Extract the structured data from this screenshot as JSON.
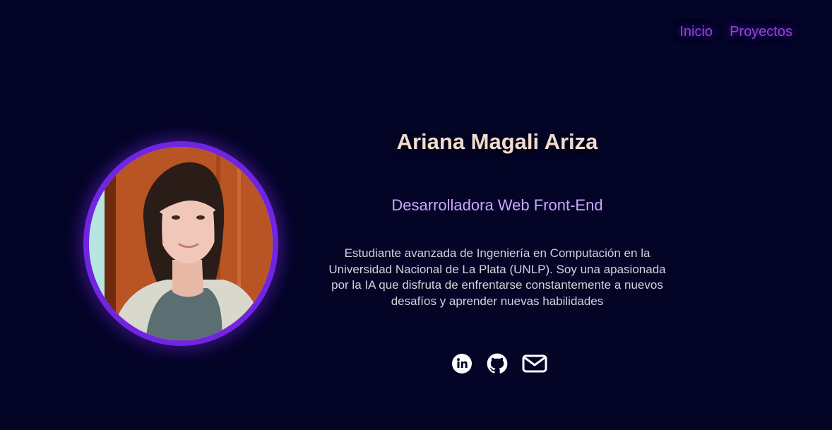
{
  "nav": {
    "items": [
      {
        "label": "Inicio"
      },
      {
        "label": "Proyectos"
      }
    ]
  },
  "profile": {
    "name": "Ariana Magali Ariza",
    "role": "Desarrolladora Web Front-End",
    "bio": "Estudiante avanzada de Ingeniería en Computación en la Universidad Nacional de La Plata (UNLP). Soy una apasionada por la IA que disfruta de enfrentarse constantemente a nuevos desafíos y aprender nuevas habilidades"
  },
  "social": {
    "icons": [
      "linkedin-icon",
      "github-icon",
      "email-icon"
    ]
  },
  "colors": {
    "background": "#040427",
    "accent": "#7125e0",
    "nav_link": "#8f45d8",
    "name": "#f0dccd",
    "role": "#c9a7ff",
    "bio": "#d5d2da"
  }
}
